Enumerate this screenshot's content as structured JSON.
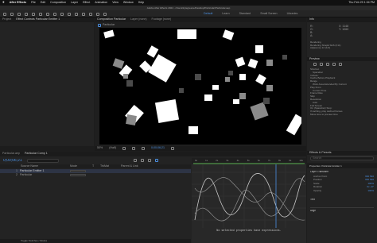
{
  "menubar": {
    "app_name": "After Effects",
    "items": [
      "File",
      "Edit",
      "Composition",
      "Layer",
      "Effect",
      "Animation",
      "View",
      "Window",
      "Help"
    ],
    "clock": "Thu Feb 29  1:34 PM"
  },
  "titlebar": {
    "title": "Adobe After Effects 2024 - /Users/kylegreene/Desktop/Particular/Particular.aep"
  },
  "workspace_tabs": [
    "Default",
    "Learn",
    "Standard",
    "Small Screen",
    "Libraries"
  ],
  "project_panel": {
    "tabs": [
      "Project",
      "Effect Controls Particular Emitter 1"
    ]
  },
  "comp_panel": {
    "tabs": [
      "Composition Particular",
      "Layer (none)",
      "Footage (none)"
    ],
    "breadcrumb": [
      "Particular"
    ],
    "zoom": "50%",
    "resolution": "(Half)",
    "timecode": "0;00;06;21"
  },
  "right_panel": {
    "header": "Info",
    "info_lines": [
      "R:",
      "G:",
      "B:",
      "A:"
    ],
    "info_detail": [
      "X: 1148",
      "Y: 1060"
    ],
    "footage_lines": [
      "Rendering",
      "Rendering ShapE SHS (F11)",
      "Adjacency 12 (1/4)"
    ],
    "preview_header": "Preview",
    "preview_items": [
      "Shortcut",
      "Spacebar",
      "Include:",
      "Cache Before Playback",
      "Range",
      "Work Area Extended By Current",
      "Play From",
      "Current Time",
      "Frame Rate",
      "Skip",
      "Resolution",
      "Auto",
      "Full Screen",
      "On (Spacebar) Stop:",
      "If caching, play cached frames",
      "Move time to preview time"
    ],
    "effects_header": "Effects & Presets",
    "effects_search_placeholder": "Search"
  },
  "timeline": {
    "tabs": [
      "Particular.aep",
      "Particular Comp 1"
    ],
    "timecode": "0;00;06;21",
    "columns": [
      "Source Name",
      "Mode",
      "T",
      "TrkMat",
      "Parent & Link"
    ],
    "layers": [
      {
        "num": "1",
        "name": "Particular Emitter 1"
      },
      {
        "num": "2",
        "name": "Particular"
      }
    ],
    "ruler_ticks": [
      "0s",
      "1s",
      "2s",
      "3s",
      "4s",
      "5s",
      "6s",
      "7s",
      "8s",
      "9s",
      "10s"
    ],
    "status": "No selected properties have expressions.",
    "footer": "Toggle Switches / Modes"
  },
  "properties_panel": {
    "header": "Properties: Particular Emitter 1",
    "section": "Layer Transform",
    "rows": [
      {
        "label": "Anchor Point",
        "value": "960  540"
      },
      {
        "label": "Position",
        "value": "960  540"
      },
      {
        "label": "Scale",
        "value": "100%"
      },
      {
        "label": "Rotation",
        "value": "0x +0°"
      },
      {
        "label": "Opacity",
        "value": "100%"
      }
    ],
    "text_header": "Text",
    "align_header": "Align"
  },
  "colors": {
    "accent": "#4a8fe0",
    "keyframe_curve": "#c8c8c8"
  }
}
